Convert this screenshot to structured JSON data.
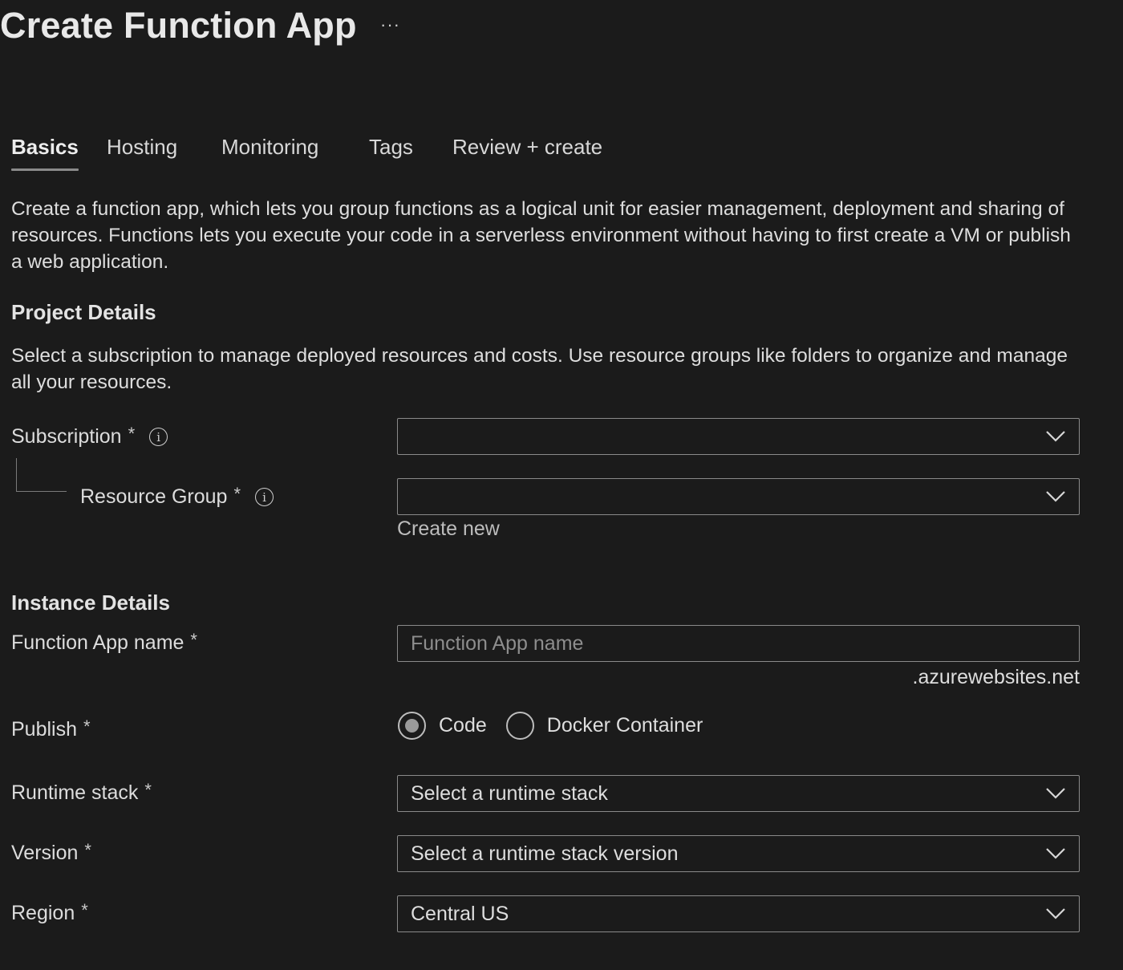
{
  "header": {
    "title": "Create Function App",
    "more_label": "···"
  },
  "tabs": [
    {
      "label": "Basics",
      "active": true
    },
    {
      "label": "Hosting",
      "active": false
    },
    {
      "label": "Monitoring",
      "active": false
    },
    {
      "label": "Tags",
      "active": false
    },
    {
      "label": "Review + create",
      "active": false
    }
  ],
  "intro": "Create a function app, which lets you group functions as a logical unit for easier management, deployment and sharing of resources. Functions lets you execute your code in a serverless environment without having to first create a VM or publish a web application.",
  "project": {
    "heading": "Project Details",
    "description": "Select a subscription to manage deployed resources and costs. Use resource groups like folders to organize and manage all your resources.",
    "subscription": {
      "label": "Subscription",
      "required": "*",
      "info_icon": "i",
      "value": ""
    },
    "resource_group": {
      "label": "Resource Group",
      "required": "*",
      "info_icon": "i",
      "value": "",
      "create_new": "Create new"
    }
  },
  "instance": {
    "heading": "Instance Details",
    "app_name": {
      "label": "Function App name",
      "required": "*",
      "placeholder": "Function App name",
      "value": "",
      "suffix": ".azurewebsites.net"
    },
    "publish": {
      "label": "Publish",
      "required": "*",
      "options": [
        "Code",
        "Docker Container"
      ],
      "selected": "Code"
    },
    "runtime_stack": {
      "label": "Runtime stack",
      "required": "*",
      "value": "Select a runtime stack"
    },
    "version": {
      "label": "Version",
      "required": "*",
      "value": "Select a runtime stack version"
    },
    "region": {
      "label": "Region",
      "required": "*",
      "value": "Central US"
    }
  },
  "colors": {
    "background": "#1b1b1b",
    "text": "#dedede",
    "field_border": "#8a8a8a",
    "tab_underline": "#8a8a8a",
    "radio_selected": "#9a9a9a"
  },
  "icons": {
    "dropdown": "chevron-down-icon",
    "info": "info-icon",
    "more": "more-horizontal-icon"
  }
}
